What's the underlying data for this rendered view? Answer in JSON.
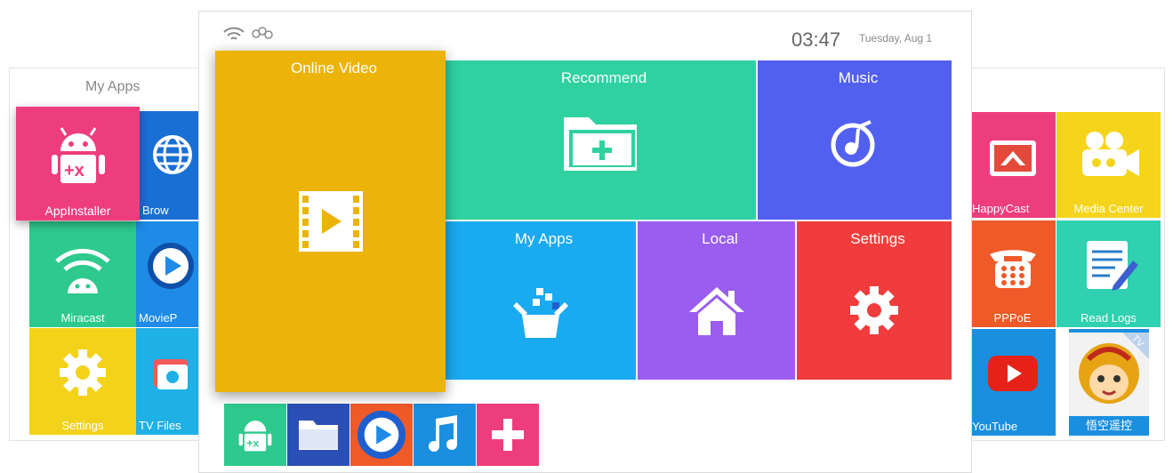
{
  "left_panel": {
    "title": "My Apps",
    "apps": [
      {
        "label": "AppInstaller",
        "color": "#ee3d7d",
        "icon": "android-installer-icon"
      },
      {
        "label": "Brow",
        "color": "#1a6fd4",
        "icon": "globe-icon"
      },
      {
        "label": "Miracast",
        "color": "#2ec98d",
        "icon": "android-wifi-icon"
      },
      {
        "label": "MovieP",
        "color": "#1e8be6",
        "icon": "play-circle-icon"
      },
      {
        "label": "Settings",
        "color": "#f3d21a",
        "icon": "gear-icon"
      },
      {
        "label": "TV Files",
        "color": "#1fb0e5",
        "icon": "folder-icon"
      }
    ]
  },
  "right_panel": {
    "apps": [
      {
        "label": "HappyCast",
        "color": "#ee3d7d",
        "icon": "cast-icon"
      },
      {
        "label": "Media Center",
        "color": "#f5d51b",
        "icon": "camera-icon"
      },
      {
        "label": "PPPoE",
        "color": "#f05a28",
        "icon": "phone-icon"
      },
      {
        "label": "Read Logs",
        "color": "#2fd1b0",
        "icon": "notepad-icon"
      },
      {
        "label": "YouTube",
        "color": "#1a8fe0",
        "icon": "youtube-icon"
      },
      {
        "label": "悟空遥控",
        "color": "#1a8fe0",
        "icon": "monkey-icon",
        "badge": "TV"
      }
    ]
  },
  "status": {
    "time": "03:47",
    "date": "Tuesday, Aug 1"
  },
  "tiles": [
    {
      "label": "Online Video",
      "color": "#ecb309",
      "icon": "film-icon"
    },
    {
      "label": "Recommend",
      "color": "#2fd1a0",
      "icon": "folder-add-icon"
    },
    {
      "label": "Music",
      "color": "#5260f0",
      "icon": "music-disc-icon"
    },
    {
      "label": "My Apps",
      "color": "#1aaaf0",
      "icon": "apps-box-icon"
    },
    {
      "label": "Local",
      "color": "#9b5cf0",
      "icon": "home-icon"
    },
    {
      "label": "Settings",
      "color": "#f03c3c",
      "icon": "gear-icon"
    }
  ],
  "dock": [
    {
      "color": "#2ec98d",
      "icon": "android-installer-icon"
    },
    {
      "color": "#2a4fb5",
      "icon": "folder-icon"
    },
    {
      "color": "#f05a28",
      "icon": "play-circle-icon"
    },
    {
      "color": "#1a8fe0",
      "icon": "music-note-icon"
    },
    {
      "color": "#ee3d7d",
      "icon": "plus-icon"
    }
  ]
}
